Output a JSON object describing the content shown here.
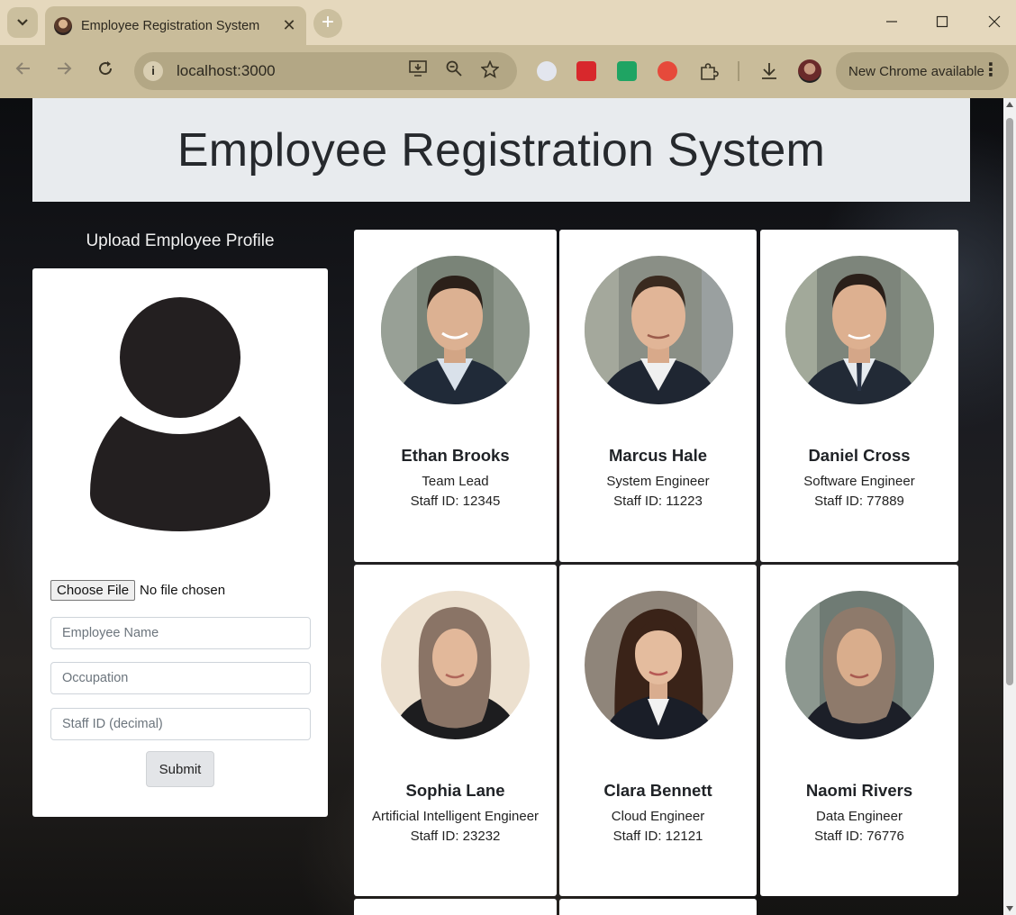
{
  "browser": {
    "tab_title": "Employee Registration System",
    "url": "localhost:3000",
    "update_label": "New Chrome available"
  },
  "page": {
    "title": "Employee Registration System",
    "upload_heading": "Upload Employee Profile",
    "form": {
      "choose_file_label": "Choose File",
      "file_status": "No file chosen",
      "name_placeholder": "Employee Name",
      "occupation_placeholder": "Occupation",
      "staff_id_placeholder": "Staff ID (decimal)",
      "submit_label": "Submit"
    },
    "employees": [
      {
        "name": "Ethan Brooks",
        "occupation": "Team Lead",
        "staff_id": "Staff ID: 12345",
        "avatar": "man-portrait"
      },
      {
        "name": "Marcus Hale",
        "occupation": "System Engineer",
        "staff_id": "Staff ID: 11223",
        "avatar": "man-portrait"
      },
      {
        "name": "Daniel Cross",
        "occupation": "Software Engineer",
        "staff_id": "Staff ID: 77889",
        "avatar": "man-portrait"
      },
      {
        "name": "Sophia Lane",
        "occupation": "Artificial Intelligent Engineer",
        "staff_id": "Staff ID: 23232",
        "avatar": "woman-hijab-portrait"
      },
      {
        "name": "Clara Bennett",
        "occupation": "Cloud Engineer",
        "staff_id": "Staff ID: 12121",
        "avatar": "woman-portrait"
      },
      {
        "name": "Naomi Rivers",
        "occupation": "Data Engineer",
        "staff_id": "Staff ID: 76776",
        "avatar": "woman-hijab-portrait"
      }
    ]
  },
  "colors": {
    "header_bg": "#e8ebee",
    "card_bg": "#ffffff",
    "browser_frame": "#e5d8bd"
  }
}
